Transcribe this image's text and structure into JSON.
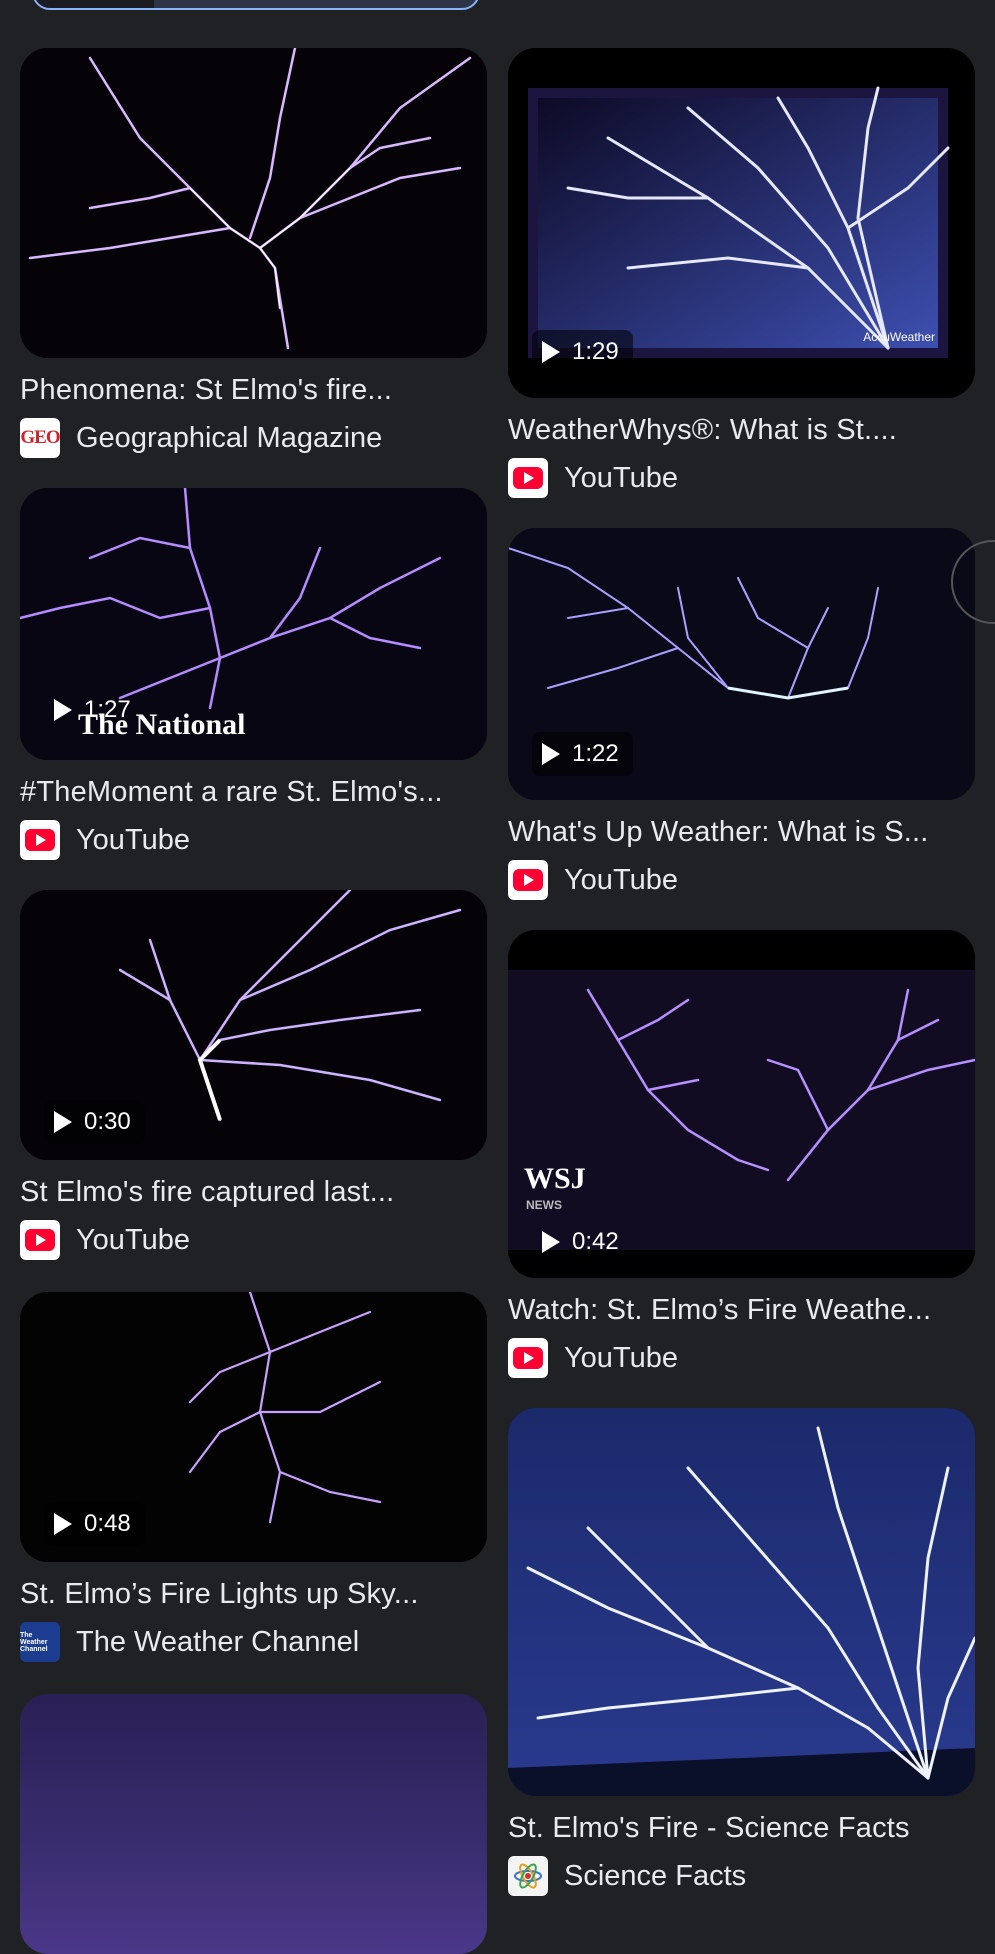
{
  "results": {
    "left": [
      {
        "title": "Phenomena: St Elmo's fire...",
        "source": "Geographical Magazine",
        "favicon": "geo-icon",
        "duration": ""
      },
      {
        "title": "#TheMoment a rare St. Elmo's...",
        "source": "YouTube",
        "favicon": "youtube-icon",
        "duration": "1:27",
        "overlay": "The National"
      },
      {
        "title": "St Elmo's fire captured last...",
        "source": "YouTube",
        "favicon": "youtube-icon",
        "duration": "0:30"
      },
      {
        "title": "St. Elmo’s Fire Lights up Sky...",
        "source": "The Weather Channel",
        "favicon": "weather-channel-icon",
        "duration": "0:48"
      }
    ],
    "right": [
      {
        "title": "WeatherWhys®: What is St....",
        "source": "YouTube",
        "favicon": "youtube-icon",
        "duration": "1:29",
        "overlay": "AccuWeather"
      },
      {
        "title": "What's Up Weather: What is S...",
        "source": "YouTube",
        "favicon": "youtube-icon",
        "duration": "1:22"
      },
      {
        "title": "Watch: St. Elmo’s Fire Weathe...",
        "source": "YouTube",
        "favicon": "youtube-icon",
        "duration": "0:42",
        "overlay": "WSJ",
        "overlay2": "NEWS"
      },
      {
        "title": "St. Elmo's Fire - Science Facts",
        "source": "Science Facts",
        "favicon": "science-facts-icon",
        "duration": ""
      }
    ]
  },
  "favicon_text": {
    "geo": "GEO",
    "twc": "The Weather Channel"
  },
  "colors": {
    "background": "#202124",
    "text": "#e8eaed",
    "youtube": "#ff0033",
    "lightning": "#c9a8ff"
  }
}
